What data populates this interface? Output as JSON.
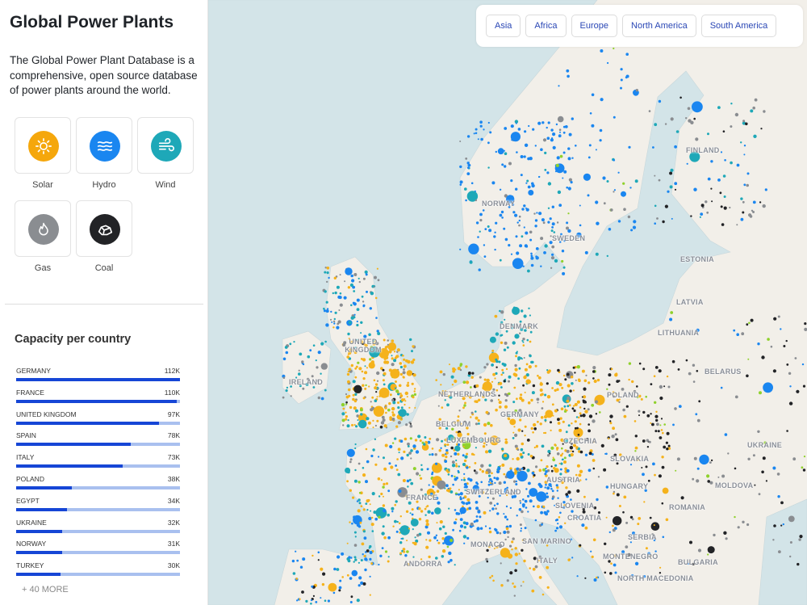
{
  "sidebar": {
    "title": "Global Power Plants",
    "description": "The Global Power Plant Database is a comprehensive, open source database of power plants around the world.",
    "fuels": [
      {
        "label": "Solar",
        "icon": "sun-icon",
        "color": "#f5a70c"
      },
      {
        "label": "Hydro",
        "icon": "waves-icon",
        "color": "#1a86f0"
      },
      {
        "label": "Wind",
        "icon": "wind-icon",
        "color": "#1ea8b8"
      },
      {
        "label": "Gas",
        "icon": "flame-icon",
        "color": "#8a8d91"
      },
      {
        "label": "Coal",
        "icon": "coal-icon",
        "color": "#222326"
      }
    ],
    "capacity_title": "Capacity per country",
    "countries": [
      {
        "name": "GERMANY",
        "value": "112K",
        "fraction": 1.0
      },
      {
        "name": "FRANCE",
        "value": "110K",
        "fraction": 0.98
      },
      {
        "name": "UNITED KINGDOM",
        "value": "97K",
        "fraction": 0.87
      },
      {
        "name": "SPAIN",
        "value": "78K",
        "fraction": 0.7
      },
      {
        "name": "ITALY",
        "value": "73K",
        "fraction": 0.65
      },
      {
        "name": "POLAND",
        "value": "38K",
        "fraction": 0.34
      },
      {
        "name": "EGYPT",
        "value": "34K",
        "fraction": 0.31
      },
      {
        "name": "UKRAINE",
        "value": "32K",
        "fraction": 0.28
      },
      {
        "name": "NORWAY",
        "value": "31K",
        "fraction": 0.28
      },
      {
        "name": "TURKEY",
        "value": "30K",
        "fraction": 0.27
      }
    ],
    "more": "+ 40 MORE"
  },
  "regions": [
    "Asia",
    "Africa",
    "Europe",
    "North America",
    "South America"
  ],
  "map": {
    "labels": [
      "NORWAY",
      "SWEDEN",
      "FINLAND",
      "ESTONIA",
      "LATVIA",
      "LITHUANIA",
      "DENMARK",
      "BELARUS",
      "UNITED KINGDOM",
      "IRELAND",
      "NETHERLANDS",
      "BELGIUM",
      "LUXEMBOURG",
      "GERMANY",
      "POLAND",
      "CZECHIA",
      "SLOVAKIA",
      "UKRAINE",
      "MOLDOVA",
      "HUNGARY",
      "ROMANIA",
      "AUSTRIA",
      "SWITZERLAND",
      "FRANCE",
      "SLOVENIA",
      "CROATIA",
      "SERBIA",
      "SAN MARINO",
      "MONACO",
      "ITALY",
      "MONTENEGRO",
      "BULGARIA",
      "NORTH MACEDONIA",
      "ANDORRA"
    ],
    "colors": {
      "land": "#f2efe9",
      "sea": "#d3e4e8",
      "solar": "#f5b21b",
      "hydro": "#1a86f0",
      "wind": "#1ea8b8",
      "gas": "#8a8d91",
      "coal": "#222326",
      "biomass": "#8fd12c"
    }
  }
}
